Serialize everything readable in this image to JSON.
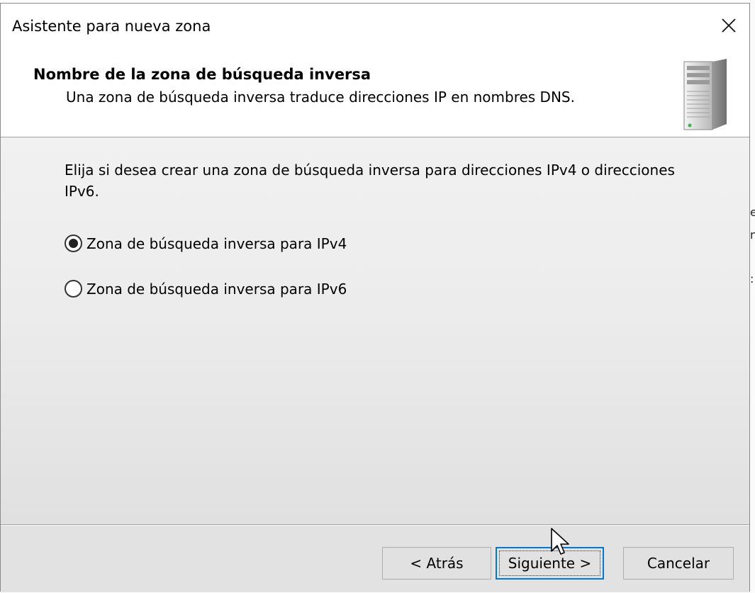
{
  "window": {
    "title": "Asistente para nueva zona",
    "close_icon": "close-icon"
  },
  "header": {
    "title": "Nombre de la zona de búsqueda inversa",
    "subtitle": "Una zona de búsqueda inversa traduce direcciones IP en nombres DNS.",
    "icon": "server-icon"
  },
  "body": {
    "instruction": "Elija si desea crear una zona de búsqueda inversa para direcciones IPv4 o direcciones IPv6.",
    "options": [
      {
        "label": "Zona de búsqueda inversa para IPv4",
        "selected": true
      },
      {
        "label": "Zona de búsqueda inversa para IPv6",
        "selected": false
      }
    ]
  },
  "footer": {
    "back_label": "< Atrás",
    "next_label": "Siguiente >",
    "cancel_label": "Cancelar"
  },
  "colors": {
    "accent": "#0078d7",
    "dialog_bg": "#f0f0f0",
    "header_bg": "#ffffff"
  }
}
